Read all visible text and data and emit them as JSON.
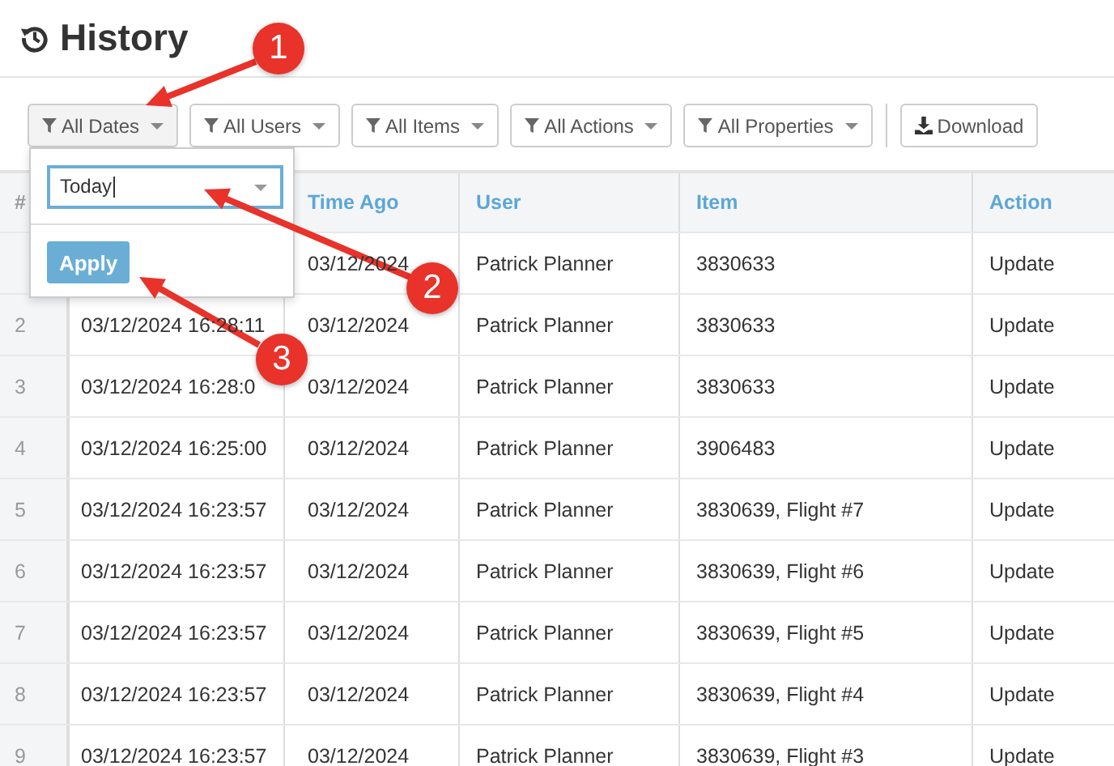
{
  "page": {
    "title": "History"
  },
  "toolbar": {
    "filters": [
      {
        "label": "All Dates",
        "open": true
      },
      {
        "label": "All Users",
        "open": false
      },
      {
        "label": "All Items",
        "open": false
      },
      {
        "label": "All Actions",
        "open": false
      },
      {
        "label": "All Properties",
        "open": false
      }
    ],
    "download": "Download"
  },
  "date_menu": {
    "value": "Today",
    "apply": "Apply"
  },
  "table": {
    "columns": [
      "#",
      null,
      "Time Ago",
      "User",
      "Item",
      "Action"
    ],
    "rows": [
      {
        "num": null,
        "date": null,
        "ago": "03/12/2024",
        "user": "Patrick Planner",
        "item": "3830633",
        "action": "Update"
      },
      {
        "num": "2",
        "date": "03/12/2024 16:28:11",
        "ago": "03/12/2024",
        "user": "Patrick Planner",
        "item": "3830633",
        "action": "Update"
      },
      {
        "num": "3",
        "date": "03/12/2024 16:28:0",
        "ago": "03/12/2024",
        "user": "Patrick Planner",
        "item": "3830633",
        "action": "Update"
      },
      {
        "num": "4",
        "date": "03/12/2024 16:25:00",
        "ago": "03/12/2024",
        "user": "Patrick Planner",
        "item": "3906483",
        "action": "Update"
      },
      {
        "num": "5",
        "date": "03/12/2024 16:23:57",
        "ago": "03/12/2024",
        "user": "Patrick Planner",
        "item": "3830639, Flight #7",
        "action": "Update"
      },
      {
        "num": "6",
        "date": "03/12/2024 16:23:57",
        "ago": "03/12/2024",
        "user": "Patrick Planner",
        "item": "3830639, Flight #6",
        "action": "Update"
      },
      {
        "num": "7",
        "date": "03/12/2024 16:23:57",
        "ago": "03/12/2024",
        "user": "Patrick Planner",
        "item": "3830639, Flight #5",
        "action": "Update"
      },
      {
        "num": "8",
        "date": "03/12/2024 16:23:57",
        "ago": "03/12/2024",
        "user": "Patrick Planner",
        "item": "3830639, Flight #4",
        "action": "Update"
      },
      {
        "num": "9",
        "date": "03/12/2024 16:23:57",
        "ago": "03/12/2024",
        "user": "Patrick Planner",
        "item": "3830639, Flight #3",
        "action": "Update"
      }
    ]
  },
  "callouts": [
    {
      "number": "1"
    },
    {
      "number": "2"
    },
    {
      "number": "3"
    }
  ]
}
